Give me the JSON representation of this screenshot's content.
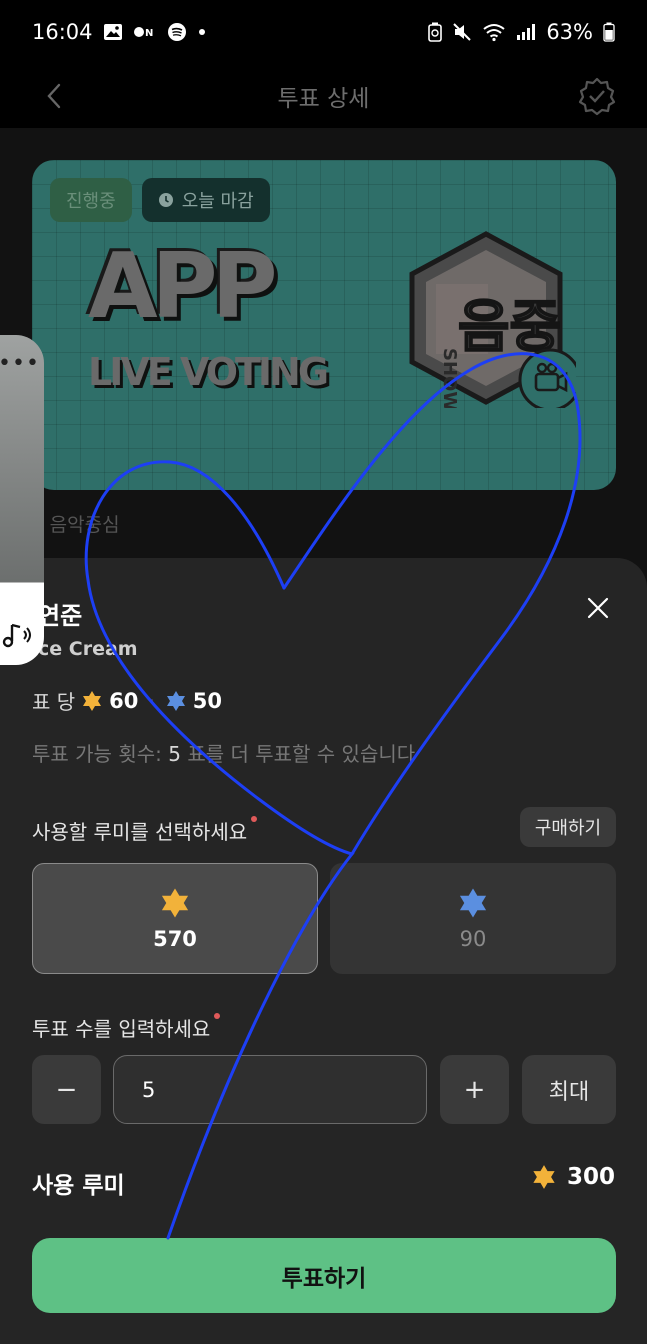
{
  "status_bar": {
    "time": "16:04",
    "battery": "63%",
    "left_icons": [
      "gallery-icon",
      "on-icon",
      "spotify-icon",
      "dot-icon"
    ],
    "right_icons": [
      "battery-saver-icon",
      "mute-icon",
      "wifi-icon",
      "signal-icon",
      "battery-icon"
    ]
  },
  "header": {
    "title": "투표 상세",
    "back_icon": "chevron-left-icon",
    "right_icon": "verified-badge-icon"
  },
  "banner": {
    "status_badge": "진행중",
    "deadline_badge": "오늘 마감",
    "headline": "APP",
    "subheadline": "LIVE VOTING",
    "logo_text_show": "SHOW",
    "logo_text_main": "음중",
    "accent": "#2f6f69"
  },
  "background_subtitle": "! 음악중심",
  "sheet": {
    "nominee_name": "연준",
    "nominee_song": "ce Cream",
    "cost": {
      "prefix": "표 당",
      "gold_value": "60",
      "separator": "·",
      "blue_value": "50"
    },
    "remaining": {
      "prefix": "투표 가능 횟수:",
      "count": "5",
      "suffix": "표를 더 투표할 수 있습니다"
    },
    "select_label": "사용할 루미를 선택하세요",
    "buy_label": "구매하기",
    "ruby_options": [
      {
        "type": "gold",
        "amount": "570",
        "selected": true,
        "color": "#f2b23a"
      },
      {
        "type": "blue",
        "amount": "90",
        "selected": false,
        "color": "#5b8fe0"
      }
    ],
    "count_label": "투표 수를 입력하세요",
    "count_value": "5",
    "minus_label": "−",
    "plus_label": "+",
    "max_label": "최대",
    "use_label": "사용 루미",
    "use_total": "300",
    "vote_label": "투표하기",
    "vote_color": "#5ec185"
  },
  "floating_media": {
    "dots": "•••",
    "icon": "music-note-icon"
  }
}
